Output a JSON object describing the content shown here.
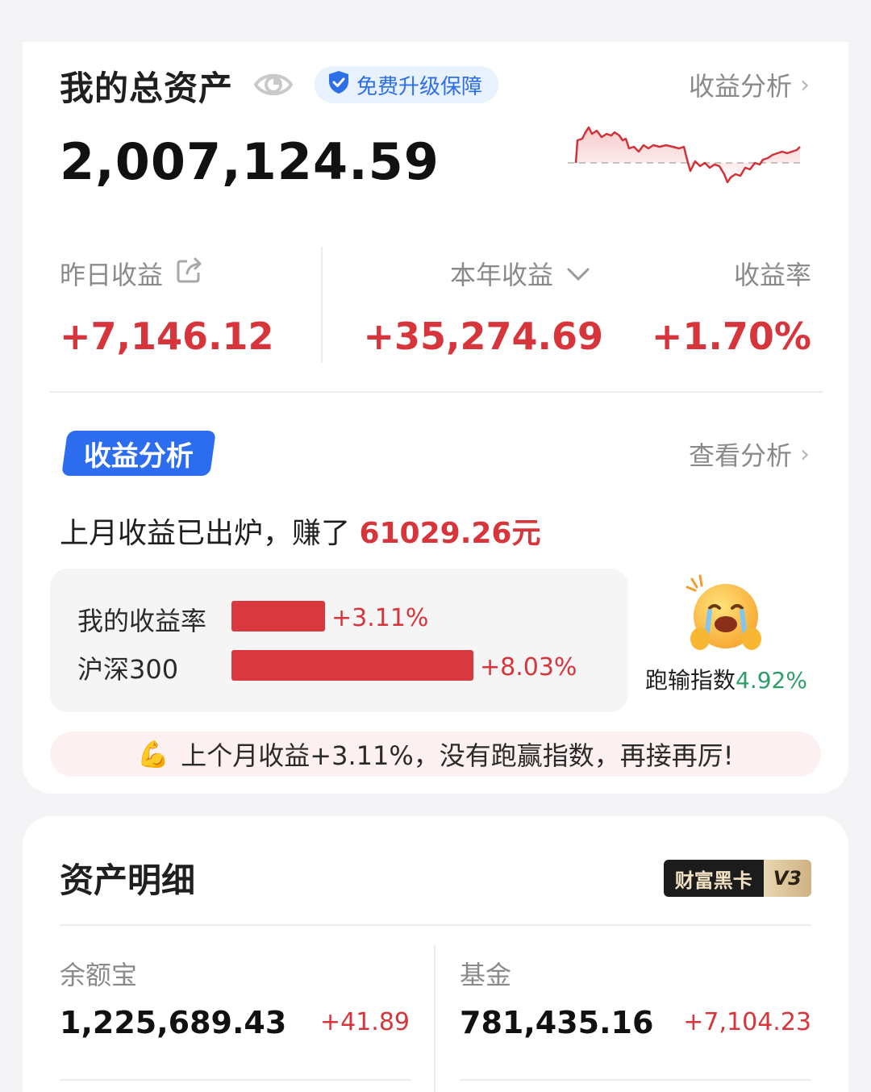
{
  "header": {
    "title": "我的总资产",
    "badge": "免费升级保障",
    "analysis_link": "收益分析",
    "total": "2,007,124.59"
  },
  "earnings": {
    "yesterday": {
      "label": "昨日收益",
      "value": "+7,146.12"
    },
    "year": {
      "label": "本年收益",
      "value": "+35,274.69"
    },
    "rate": {
      "label": "收益率",
      "value": "+1.70%"
    }
  },
  "analysis": {
    "tag": "收益分析",
    "view_link": "查看分析",
    "summary_prefix": "上月收益已出炉，赚了 ",
    "summary_amount": "61029.26元",
    "comparison": [
      {
        "label": "我的收益率",
        "value": "+3.11%",
        "percent": 3.11
      },
      {
        "label": "沪深300",
        "value": "+8.03%",
        "percent": 8.03
      }
    ],
    "lose_label": "跑输指数",
    "lose_value": "4.92%",
    "tip": "上个月收益+3.11%，没有跑赢指数，再接再厉!",
    "tip_icon": "💪"
  },
  "assets": {
    "title": "资产明细",
    "vip_label": "财富黑卡",
    "vip_level": "V3",
    "items": [
      {
        "name": "余额宝",
        "value": "1,225,689.43",
        "delta": "+41.89"
      },
      {
        "name": "基金",
        "value": "781,435.16",
        "delta": "+7,104.23"
      }
    ]
  },
  "colors": {
    "up": "#d6353b",
    "down_green": "#2e9d6a",
    "accent_blue": "#2c6df0"
  },
  "icons": [
    "eye-icon",
    "shield-check-icon",
    "chevron-right-icon",
    "share-icon",
    "chevron-down-icon",
    "crying-emoji-icon",
    "flexed-arm-icon"
  ]
}
